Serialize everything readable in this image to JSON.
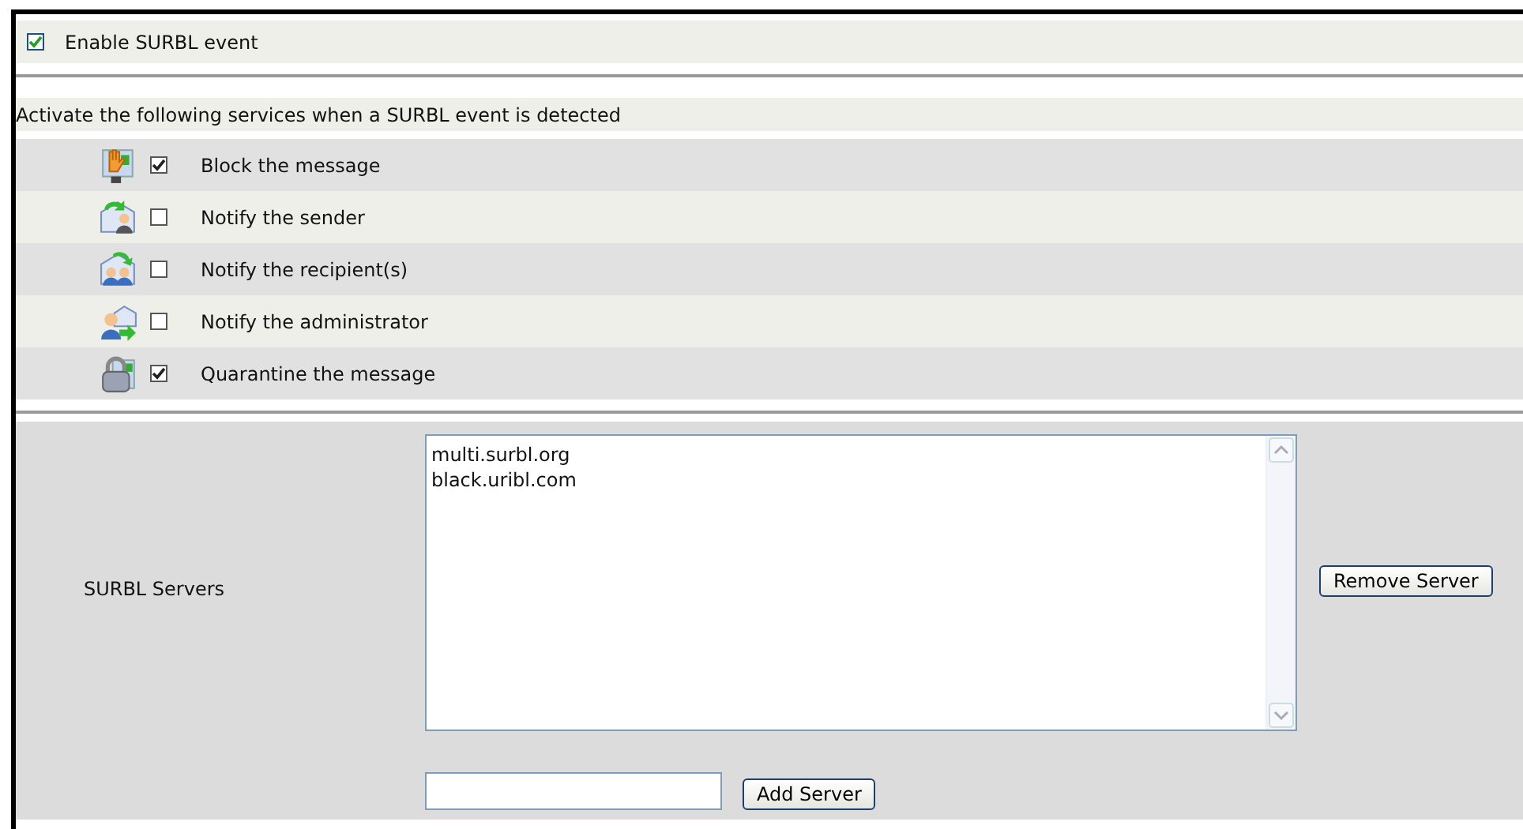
{
  "enable": {
    "label": "Enable SURBL event",
    "checked": true
  },
  "actions_heading": "Activate the following services when a SURBL event is detected",
  "actions": [
    {
      "label": "Block the message",
      "checked": true
    },
    {
      "label": "Notify the sender",
      "checked": false
    },
    {
      "label": "Notify the recipient(s)",
      "checked": false
    },
    {
      "label": "Notify the administrator",
      "checked": false
    },
    {
      "label": "Quarantine the message",
      "checked": true
    }
  ],
  "servers": {
    "label": "SURBL Servers",
    "items": [
      "multi.surbl.org",
      "black.uribl.com"
    ],
    "remove_button": "Remove Server",
    "add_button": "Add Server"
  }
}
